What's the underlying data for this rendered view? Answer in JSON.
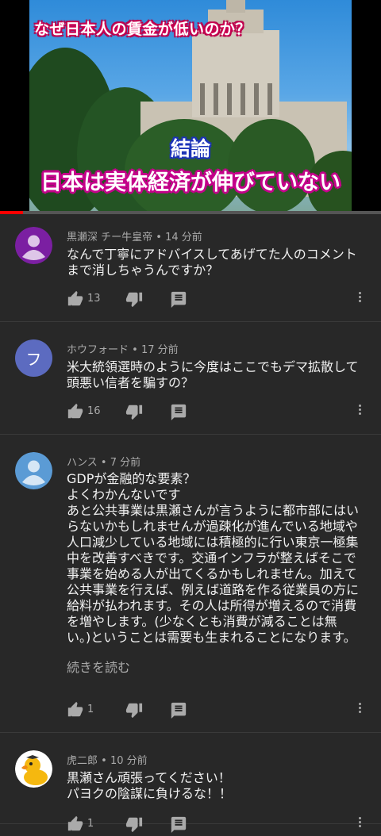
{
  "video": {
    "headline": "なぜ日本人の賃金が低いのか？",
    "conclusion": "結論",
    "subline": "日本は実体経済が伸びていない",
    "progress": 0.06
  },
  "comments": [
    {
      "author": "黒瀬深 チー牛皇帝",
      "time": "14 分前",
      "text": "なんで丁寧にアドバイスしてあげてた人のコメントまで消しちゃうんですか？",
      "likes": "13",
      "avatar": "purple-person",
      "avatar_color": "#7b1fa2"
    },
    {
      "author": "ホウフォード",
      "time": "17 分前",
      "text": "米大統領選時のように今度はここでもデマ拡散して頭悪い信者を騙すの？",
      "likes": "16",
      "avatar": "letter",
      "avatar_letter": "フ",
      "avatar_color": "#5c6bc0"
    },
    {
      "author": "ハンス",
      "time": "7 分前",
      "text": "GDPが金融的な要素？\nよくわかんないです\nあと公共事業は黒瀬さんが言うように都市部にはいらないかもしれませんが過疎化が進んでいる地域や人口減少している地域には積極的に行い東京一極集中を改善すべきです。交通インフラが整えばそこで事業を始める人が出てくるかもしれません。加えて公共事業を行えば、例えば道路を作る従業員の方に給料が払われます。その人は所得が増えるので消費を増やします。(少なくとも消費が減ることは無い。)ということは需要も生まれることになります。",
      "read_more": "続きを読む",
      "likes": "1",
      "avatar": "blue-person",
      "avatar_color": "#5b9bd5"
    },
    {
      "author": "虎二郎",
      "time": "10 分前",
      "text": "黒瀬さん頑張ってください！\nパヨクの陰謀に負けるな！！",
      "likes": "1",
      "avatar": "duck",
      "avatar_color": "#ffffff"
    }
  ],
  "icons": {
    "like": "thumbs-up-icon",
    "dislike": "thumbs-down-icon",
    "reply": "reply-icon",
    "more": "more-vert-icon"
  }
}
